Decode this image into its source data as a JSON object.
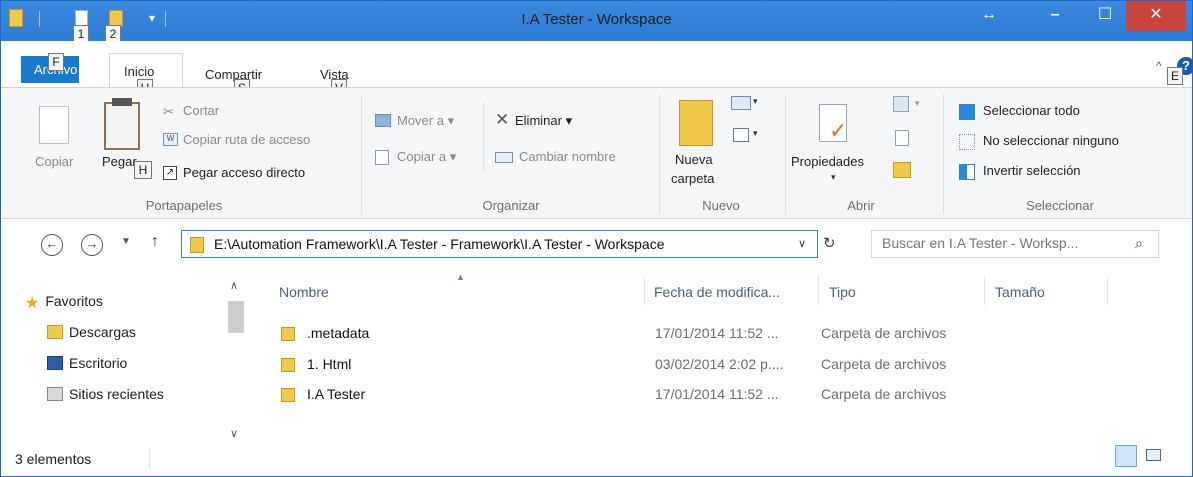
{
  "window": {
    "title": "I.A Tester - Workspace"
  },
  "quick_access": {
    "keytips": [
      "1",
      "2"
    ]
  },
  "tabs": [
    {
      "label": "Archivo",
      "keytip": "F"
    },
    {
      "label": "Inicio",
      "keytip": "H"
    },
    {
      "label": "Compartir",
      "keytip": "S"
    },
    {
      "label": "Vista",
      "keytip": "V"
    }
  ],
  "help_keytip": "E",
  "ribbon": {
    "clipboard": {
      "label": "Portapapeles",
      "copy": "Copiar",
      "paste": "Pegar",
      "cut": "Cortar",
      "copy_path": "Copiar ruta de acceso",
      "paste_shortcut": "Pegar acceso directo"
    },
    "organize": {
      "label": "Organizar",
      "move_to": "Mover a",
      "copy_to": "Copiar a",
      "delete": "Eliminar",
      "rename": "Cambiar nombre"
    },
    "new": {
      "label": "Nuevo",
      "new_folder_line1": "Nueva",
      "new_folder_line2": "carpeta"
    },
    "open": {
      "label": "Abrir",
      "properties": "Propiedades"
    },
    "select": {
      "label": "Seleccionar",
      "select_all": "Seleccionar todo",
      "select_none": "No seleccionar ninguno",
      "invert": "Invertir selección"
    }
  },
  "address": {
    "path": "E:\\Automation Framework\\I.A Tester - Framework\\I.A Tester - Workspace",
    "search_placeholder": "Buscar en I.A Tester - Worksp..."
  },
  "nav_pane": {
    "items": [
      {
        "label": "Favoritos",
        "icon": "star-icon"
      },
      {
        "label": "Descargas",
        "icon": "downloads-icon"
      },
      {
        "label": "Escritorio",
        "icon": "desktop-icon"
      },
      {
        "label": "Sitios recientes",
        "icon": "recent-places-icon"
      }
    ]
  },
  "file_list": {
    "columns": [
      "Nombre",
      "Fecha de modifica...",
      "Tipo",
      "Tamaño"
    ],
    "rows": [
      {
        "name": ".metadata",
        "date": "17/01/2014 11:52 ...",
        "type": "Carpeta de archivos"
      },
      {
        "name": "1. Html",
        "date": "03/02/2014 2:02 p....",
        "type": "Carpeta de archivos"
      },
      {
        "name": "I.A Tester",
        "date": "17/01/2014 11:52 ...",
        "type": "Carpeta de archivos"
      }
    ]
  },
  "status": {
    "count": "3 elementos"
  },
  "colors": {
    "titlebar": "#2d7bd6",
    "file_tab": "#1979ca",
    "close": "#c8453b",
    "folder": "#f0c84b"
  }
}
